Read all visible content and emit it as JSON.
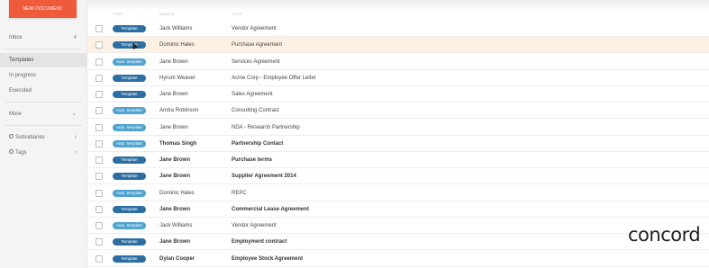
{
  "sidebar": {
    "new_document": "NEW DOCUMENT",
    "inbox": {
      "label": "Inbox",
      "count": "4"
    },
    "templates": "Templates",
    "in_progress": "In progress",
    "executed": "Executed",
    "more": "More",
    "subsidiaries": "Subsidiaries",
    "tags": "Tags"
  },
  "columns": {
    "type": "type",
    "owner": "owner",
    "title": "title"
  },
  "rows": [
    {
      "badge": "Template",
      "kind": "template",
      "owner": "Jack Williams",
      "title": "Vendor Agreement",
      "bold": false
    },
    {
      "badge": "Template",
      "kind": "template",
      "owner": "Dominic Hales",
      "title": "Purchase Agreement",
      "bold": false
    },
    {
      "badge": "Auto. template",
      "kind": "auto",
      "owner": "Jane Brown",
      "title": "Services Agreement",
      "bold": false
    },
    {
      "badge": "Template",
      "kind": "template",
      "owner": "Hyrum Weaver",
      "title": "Acme Corp - Employee Offer Letter",
      "bold": false
    },
    {
      "badge": "Template",
      "kind": "template",
      "owner": "Jane Brown",
      "title": "Sales Agreement",
      "bold": false
    },
    {
      "badge": "Auto. template",
      "kind": "auto",
      "owner": "Andra Robinson",
      "title": "Consulting Contract",
      "bold": false
    },
    {
      "badge": "Auto. template",
      "kind": "auto",
      "owner": "Jane Brown",
      "title": "NDA - Research Partnership",
      "bold": false
    },
    {
      "badge": "Auto. template",
      "kind": "auto",
      "owner": "Thomas Singh",
      "title": "Partnership Contact",
      "bold": true
    },
    {
      "badge": "Template",
      "kind": "template",
      "owner": "Jane Brown",
      "title": "Purchase terms",
      "bold": true
    },
    {
      "badge": "Template",
      "kind": "template",
      "owner": "Jane Brown",
      "title": "Supplier Agreement 2014",
      "bold": true
    },
    {
      "badge": "Auto. template",
      "kind": "auto",
      "owner": "Dominic Hales",
      "title": "REPC",
      "bold": false
    },
    {
      "badge": "Template",
      "kind": "template",
      "owner": "Jane Brown",
      "title": "Commercial Lease Agreement",
      "bold": true
    },
    {
      "badge": "Auto. template",
      "kind": "auto",
      "owner": "Jack Williams",
      "title": "Vendor Agreement",
      "bold": false
    },
    {
      "badge": "Template",
      "kind": "template",
      "owner": "Jane Brown",
      "title": "Employment contract",
      "bold": true
    },
    {
      "badge": "Template",
      "kind": "template",
      "owner": "Dylan Cooper",
      "title": "Employee Stock Agreement",
      "bold": true
    }
  ],
  "brand": {
    "logo_text": "concord"
  },
  "colors": {
    "accent": "#ef5b3a",
    "template_badge": "#2c6ea2",
    "auto_badge": "#4fa3cf",
    "highlight_row": "#fdf1e3"
  }
}
